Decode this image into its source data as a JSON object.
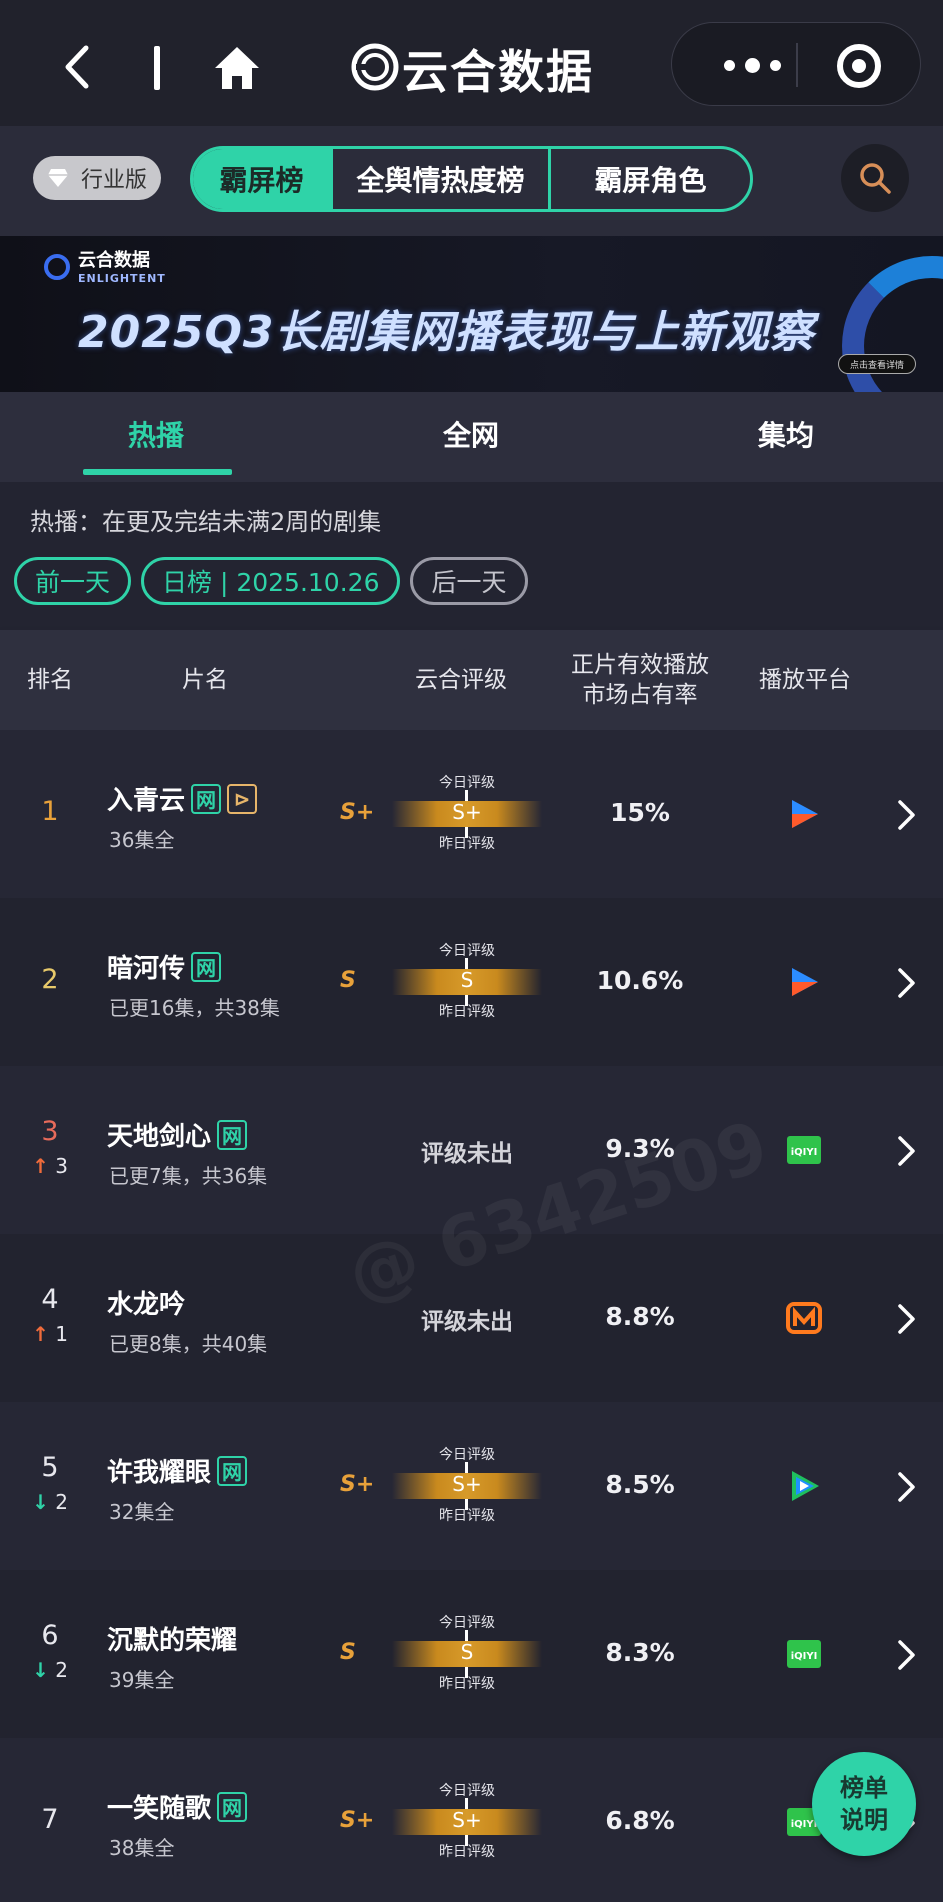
{
  "navbar": {
    "title": "云合数据"
  },
  "toprow": {
    "edition_label": "行业版",
    "tabs": [
      "霸屏榜",
      "全舆情热度榜",
      "霸屏角色"
    ],
    "active_tab": 0
  },
  "banner": {
    "logo_cn": "云合数据",
    "logo_en": "ENLIGHTENT",
    "title": "2025Q3长剧集网播表现与上新观察",
    "button": "点击查看详情"
  },
  "subtabs": [
    "热播",
    "全网",
    "集均"
  ],
  "description": "热播：在更及完结未满2周的剧集",
  "datebar": {
    "prev": "前一天",
    "current": "日榜 | 2025.10.26",
    "next": "后一天"
  },
  "table_header": {
    "rank": "排名",
    "title": "片名",
    "grade": "云合评级",
    "share_line1": "正片有效播放",
    "share_line2": "市场占有率",
    "platform": "播放平台"
  },
  "grade_labels": {
    "today": "今日评级",
    "yesterday": "昨日评级",
    "none": "评级未出"
  },
  "rows": [
    {
      "rank": "1",
      "rank_color": "#e8a13a",
      "trend": "",
      "trend_dir": "",
      "title": "入青云",
      "tags": [
        "网",
        "⊳"
      ],
      "episodes": "36集全",
      "grade_yesterday": "S+",
      "grade_today": "S+",
      "share": "15%",
      "platform": "youku"
    },
    {
      "rank": "2",
      "rank_color": "#e8c96a",
      "trend": "",
      "trend_dir": "",
      "title": "暗河传",
      "tags": [
        "网"
      ],
      "episodes": "已更16集，共38集",
      "grade_yesterday": "S",
      "grade_today": "S",
      "share": "10.6%",
      "platform": "youku"
    },
    {
      "rank": "3",
      "rank_color": "#e86b5b",
      "trend": "3",
      "trend_dir": "up",
      "title": "天地剑心",
      "tags": [
        "网"
      ],
      "episodes": "已更7集，共36集",
      "grade_yesterday": "",
      "grade_today": "",
      "share": "9.3%",
      "platform": "iqiyi"
    },
    {
      "rank": "4",
      "rank_color": "#e8e8ee",
      "trend": "1",
      "trend_dir": "up",
      "title": "水龙吟",
      "tags": [],
      "episodes": "已更8集，共40集",
      "grade_yesterday": "",
      "grade_today": "",
      "share": "8.8%",
      "platform": "mango"
    },
    {
      "rank": "5",
      "rank_color": "#e8e8ee",
      "trend": "2",
      "trend_dir": "down",
      "title": "许我耀眼",
      "tags": [
        "网"
      ],
      "episodes": "32集全",
      "grade_yesterday": "S+",
      "grade_today": "S+",
      "share": "8.5%",
      "platform": "tencent"
    },
    {
      "rank": "6",
      "rank_color": "#e8e8ee",
      "trend": "2",
      "trend_dir": "down",
      "title": "沉默的荣耀",
      "tags": [],
      "episodes": "39集全",
      "grade_yesterday": "S",
      "grade_today": "S",
      "share": "8.3%",
      "platform": "iqiyi"
    },
    {
      "rank": "7",
      "rank_color": "#e8e8ee",
      "trend": "",
      "trend_dir": "",
      "title": "一笑随歌",
      "tags": [
        "网"
      ],
      "episodes": "38集全",
      "grade_yesterday": "S+",
      "grade_today": "S+",
      "share": "6.8%",
      "platform": "iqiyi"
    }
  ],
  "fab": {
    "line1": "榜单",
    "line2": "说明"
  },
  "watermark": "@ 6342509",
  "colors": {
    "accent": "#2fd3a8",
    "gold": "#e8a13a",
    "background": "#232431"
  }
}
